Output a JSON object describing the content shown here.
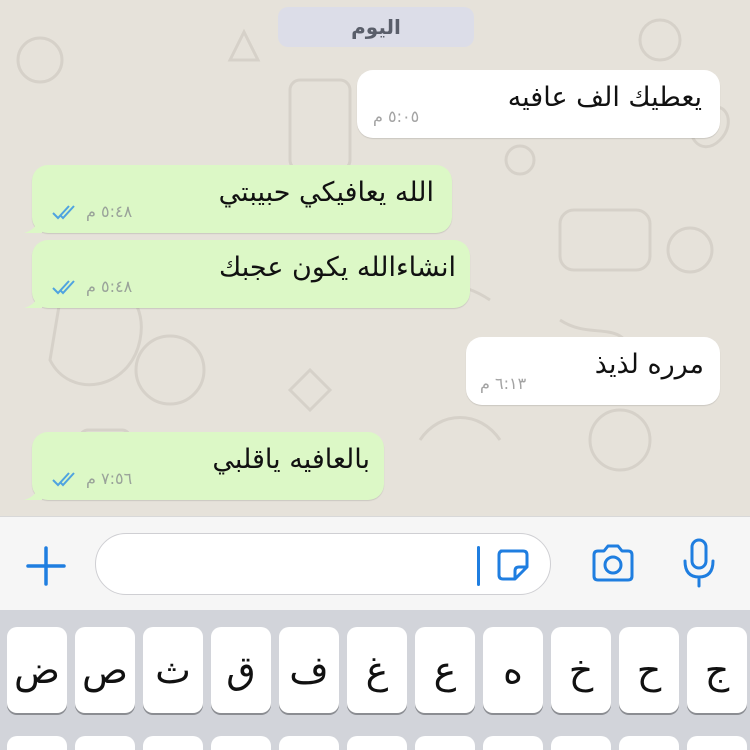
{
  "date_divider": "اليوم",
  "messages": [
    {
      "direction": "in",
      "text": "يعطيك الف عافيه",
      "time": "٥:٠٥ م"
    },
    {
      "direction": "out",
      "text": "الله يعافيكي حبيبتي",
      "time": "٥:٤٨ م",
      "read": true
    },
    {
      "direction": "out",
      "text": "انشاءالله يكون عجبك",
      "time": "٥:٤٨ م",
      "read": true
    },
    {
      "direction": "in",
      "text": "مرره لذيذ",
      "time": "٦:١٣ م"
    },
    {
      "direction": "out",
      "text": "بالعافيه ياقلبي",
      "time": "٧:٥٦ م",
      "read": true
    }
  ],
  "input_bar": {
    "icons": [
      "plus-icon",
      "sticker-icon",
      "camera-icon",
      "microphone-icon"
    ],
    "accent_color": "#1f7ee0"
  },
  "keyboard": {
    "row1": [
      "ج",
      "ح",
      "خ",
      "ه",
      "ع",
      "غ",
      "ف",
      "ق",
      "ث",
      "ص",
      "ض"
    ]
  },
  "colors": {
    "outgoing_bubble": "#dcf8c6",
    "incoming_bubble": "#ffffff",
    "read_ticks": "#4fa3e0",
    "chat_background": "#e6e2da"
  }
}
